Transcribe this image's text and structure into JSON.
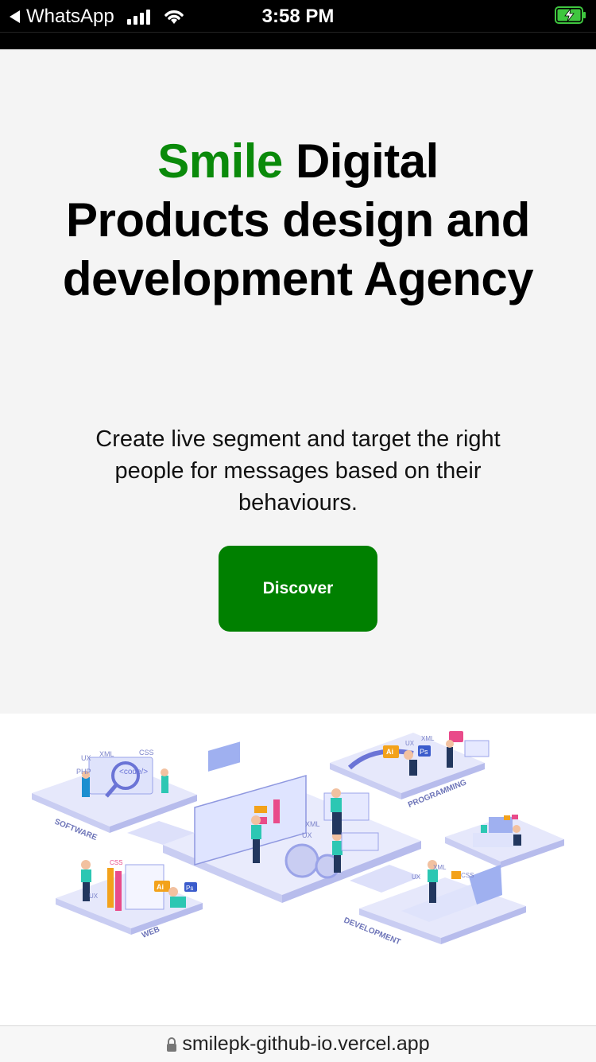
{
  "status_bar": {
    "back_app": "WhatsApp",
    "time": "3:58 PM",
    "icons": [
      "signal-icon",
      "wifi-icon",
      "battery-charging-icon"
    ]
  },
  "hero": {
    "title_accent": "Smile",
    "title_rest": " Digital Products design and development Agency",
    "subtitle": "Create live segment and target the right people for messages based on their behaviours.",
    "cta_label": "Discover"
  },
  "illustration": {
    "labels": {
      "software": "SOFTWARE",
      "programming": "PROGRAMMING",
      "web": "WEB",
      "development": "DEVELOPMENT",
      "tag_ux": "UX",
      "tag_xml": "XML",
      "tag_css": "CSS",
      "tag_ai": "Ai",
      "tag_ps": "Ps",
      "tag_php": "PHP",
      "tag_code": "<code/>"
    }
  },
  "browser": {
    "url": "smilepk-github-io.vercel.app"
  },
  "colors": {
    "accent": "#0a8a0a",
    "button": "#008000",
    "hero_bg": "#f4f4f4"
  }
}
